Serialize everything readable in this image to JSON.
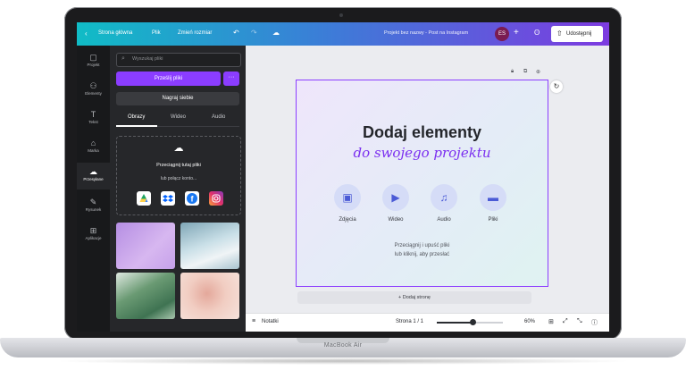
{
  "device": {
    "label": "MacBook Air"
  },
  "topbar": {
    "home": "Strona główna",
    "file": "Plik",
    "resize": "Zmień rozmiar",
    "doc_title": "Projekt bez nazwy - Post na Instagram",
    "avatar": "ES",
    "share": "Udostępnij",
    "icons": {
      "back": "chevron-left-icon",
      "undo": "undo-icon",
      "redo": "redo-icon",
      "cloud": "cloud-sync-icon",
      "add": "plus-icon",
      "analytics": "stats-icon",
      "share": "upload-icon"
    }
  },
  "rail": {
    "items": [
      {
        "label": "Projekt",
        "icon": "template-icon"
      },
      {
        "label": "Elementy",
        "icon": "elements-icon"
      },
      {
        "label": "Tekst",
        "icon": "text-icon"
      },
      {
        "label": "Marka",
        "icon": "brand-icon"
      },
      {
        "label": "Przesyłane",
        "icon": "cloud-upload-icon",
        "active": true
      },
      {
        "label": "Rysunek",
        "icon": "draw-icon"
      },
      {
        "label": "Aplikacje",
        "icon": "apps-icon"
      }
    ]
  },
  "panel": {
    "search_placeholder": "Wyszukaj pliki",
    "upload_button": "Prześlij pliki",
    "more_button": "···",
    "record_button": "Nagraj siebie",
    "tabs": [
      "Obrazy",
      "Wideo",
      "Audio"
    ],
    "active_tab": "Obrazy",
    "dropzone": {
      "title": "Przeciągnij tutaj pliki",
      "subtitle": "lub połącz konto...",
      "services": [
        {
          "name": "google-drive-icon",
          "color": "#ffffff"
        },
        {
          "name": "dropbox-icon",
          "color": "#0061fe"
        },
        {
          "name": "facebook-icon",
          "color": "#1877f2"
        },
        {
          "name": "instagram-icon",
          "color": "#e1306c"
        }
      ]
    }
  },
  "canvas": {
    "title": "Dodaj elementy",
    "subtitle": "do swojego projektu",
    "media": [
      {
        "label": "Zdjęcia",
        "icon": "image-icon",
        "glyph": "▣"
      },
      {
        "label": "Wideo",
        "icon": "video-icon",
        "glyph": "▶"
      },
      {
        "label": "Audio",
        "icon": "music-icon",
        "glyph": "♫"
      },
      {
        "label": "Pliki",
        "icon": "folder-icon",
        "glyph": "▬"
      }
    ],
    "hint_line1": "Przeciągnij i upuść pliki",
    "hint_line2": "lub kliknij, aby przesłać",
    "add_page": "+ Dodaj stronę"
  },
  "bottombar": {
    "notes": "Notatki",
    "page_indicator": "Strona 1 / 1",
    "zoom": "60%",
    "zoom_fraction": 0.55
  },
  "colors": {
    "accent": "#8b3dff",
    "dark_panel": "#26272a"
  }
}
